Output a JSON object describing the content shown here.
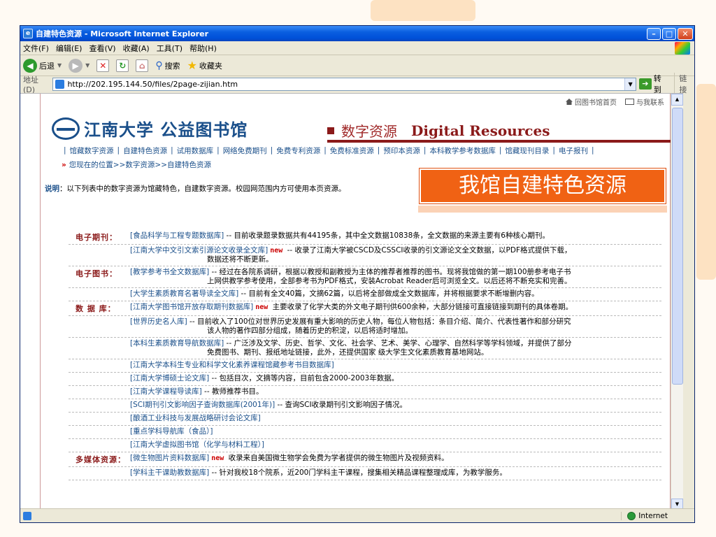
{
  "window": {
    "title": "自建特色资源 - Microsoft Internet Explorer",
    "min": "–",
    "max": "□",
    "close": "✕"
  },
  "menu": [
    "文件(F)",
    "编辑(E)",
    "查看(V)",
    "收藏(A)",
    "工具(T)",
    "帮助(H)"
  ],
  "toolbar": {
    "back": "后退",
    "search": "搜索",
    "favorites": "收藏夹"
  },
  "address": {
    "label": "地址(D)",
    "url": "http://202.195.144.50/files/2page-zijian.htm",
    "go": "转到",
    "links": "链接"
  },
  "page": {
    "top_links": {
      "home": "回图书馆首页",
      "contact": "与我联系"
    },
    "logo": "江南大学 公益图书馆",
    "section_cn": "数字资源",
    "section_en": "Digital Resources",
    "nav": [
      "馆藏数字资源",
      "自建特色资源",
      "试用数据库",
      "网络免费期刊",
      "免费专利资源",
      "免费标准资源",
      "预印本资源",
      "本科教学参考数据库",
      "馆藏现刊目录",
      "电子报刊"
    ],
    "breadcrumb": "您现在的位置>>数字资源>>自建特色资源",
    "desc_label": "说明",
    "desc_text": "：以下列表中的数字资源为馆藏特色，自建数字资源。校园网范围内方可使用本页资源。",
    "promo": "我馆自建特色资源",
    "new_tag": "new",
    "rows": [
      {
        "cat": "电子期刊：",
        "link": "[食品科学与工程专题数据库]",
        "new": false,
        "text": " -- 目前收录题录数据共有44195条，其中全文数据10838条，全文数据的来源主要有6种核心期刊。",
        "cont": ""
      },
      {
        "cat": "",
        "link": "[江南大学中文引文索引源论文收录全文库]",
        "new": true,
        "text": " -- 收录了江南大学被CSCD及CSSCI收录的引文源论文全文数据，以PDF格式提供下载，",
        "cont": "数据还将不断更新。"
      },
      {
        "cat": "电子图书：",
        "link": "[教学参考书全文数据库]",
        "new": false,
        "text": " -- 经过在各院系调研，根据以教授和副教授为主体的推荐者推荐的图书。现将我馆做的第一期100册参考电子书",
        "cont": "上网供教学参考使用，全部参考书为PDF格式，安装Acrobat Reader后可浏览全文。以后还将不断充实和完善。"
      },
      {
        "cat": "",
        "link": "[大学生素质教育名著导读全文库]",
        "new": false,
        "text": " -- 目前有全文40篇，文摘62篇，以后将全部做成全文数据库，并将根据要求不断增删内容。",
        "cont": ""
      },
      {
        "cat": "数 据 库：",
        "link": "[江南大学图书馆开放存取期刊数据库]",
        "new": true,
        "text": " 主要收录了化学大类的外文电子期刊供600余种，大部分链接可直接链接到期刊的具体卷期。",
        "cont": ""
      },
      {
        "cat": "",
        "link": "[世界历史名人库]",
        "new": false,
        "text": " -- 目前收入了100位对世界历史发展有重大影响的历史人物，每位人物包括：条目介绍、简介、代表性著作和部分研究",
        "cont": "该人物的著作四部分组成，随着历史的积淀，以后将适时增加。"
      },
      {
        "cat": "",
        "link": "[本科生素质教育导航数据库]",
        "new": false,
        "text": " -- 广泛涉及文学、历史、哲学、文化、社会学、艺术、美学、心理学、自然科学等学科领域，并提供了部分",
        "cont": "免费图书、期刊、报纸地址链接，此外，还提供国家 级大学生文化素质教育基地网站。"
      },
      {
        "cat": "",
        "link": "[江南大学本科生专业和科学文化素养课程馆藏参考书目数据库]",
        "new": false,
        "text": "",
        "cont": ""
      },
      {
        "cat": "",
        "link": "[江南大学博硕士论文库]",
        "new": false,
        "text": " -- 包括目次，文摘等内容，目前包含2000-2003年数据。",
        "cont": ""
      },
      {
        "cat": "",
        "link": "[江南大学课程导读库]",
        "new": false,
        "text": " -- 教师推荐书目。",
        "cont": ""
      },
      {
        "cat": "",
        "link": "[SCI期刊引文影响因子查询数据库(2001年)]",
        "new": false,
        "text": " -- 查询SCI收录期刊引文影响因子情况。",
        "cont": ""
      },
      {
        "cat": "",
        "link": "[酿酒工业科技与发展战略研讨会论文库]",
        "new": false,
        "text": "",
        "cont": ""
      },
      {
        "cat": "",
        "link": "[重点学科导航库（食品）]",
        "new": false,
        "text": "",
        "cont": ""
      },
      {
        "cat": "",
        "link": "[江南大学虚拟图书馆（化学与材料工程）]",
        "new": false,
        "text": "",
        "cont": ""
      },
      {
        "cat": "多媒体资源：",
        "link": "[微生物图片资料数据库]",
        "new": true,
        "text": " 收录来自美国微生物学会免费为学者提供的微生物图片及视频资料。",
        "cont": ""
      },
      {
        "cat": "",
        "link": "[学科主干课助教数据库]",
        "new": false,
        "text": " -- 针对我校18个院系，近200门学科主干课程，搜集相关精品课程整理成库，为教学服务。",
        "cont": ""
      }
    ]
  },
  "status": {
    "zone": "Internet"
  }
}
